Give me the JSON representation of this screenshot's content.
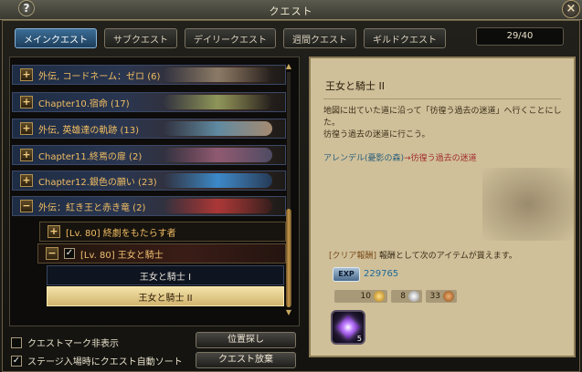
{
  "window": {
    "title": "クエスト",
    "help_label": "?",
    "close_label": "×"
  },
  "tabs": [
    {
      "label": "メインクエスト",
      "active": true
    },
    {
      "label": "サブクエスト",
      "active": false
    },
    {
      "label": "デイリークエスト",
      "active": false
    },
    {
      "label": "週間クエスト",
      "active": false
    },
    {
      "label": "ギルドクエスト",
      "active": false
    }
  ],
  "quest_count": "29/40",
  "quest_list": {
    "categories": [
      {
        "toggle": "+",
        "label": "外伝, コードネーム：ゼロ (6)"
      },
      {
        "toggle": "+",
        "label": "Chapter10.宿命 (17)"
      },
      {
        "toggle": "+",
        "label": "外伝, 英雄達の軌跡 (13)"
      },
      {
        "toggle": "+",
        "label": "Chapter11.終焉の扉 (2)"
      },
      {
        "toggle": "+",
        "label": "Chapter12.銀色の願い (23)"
      },
      {
        "toggle": "−",
        "label": "外伝：紅き王と赤き竜 (2)"
      }
    ],
    "subgroups": [
      {
        "toggle": "+",
        "label": "[Lv. 80] 終劇をもたらす者"
      },
      {
        "toggle": "−",
        "checked": "✓",
        "label": "[Lv. 80] 王女と騎士"
      }
    ],
    "items": [
      {
        "label": "王女と騎士 I",
        "selected": false
      },
      {
        "label": "王女と騎士 II",
        "selected": true
      }
    ]
  },
  "options": {
    "hide_quest_mark": {
      "label": "クエストマーク非表示",
      "checked": ""
    },
    "auto_sort": {
      "label": "ステージ入場時にクエスト自動ソート",
      "checked": "✓"
    }
  },
  "buttons": {
    "locate": "位置探し",
    "abandon": "クエスト放棄"
  },
  "detail": {
    "title": "王女と騎士 II",
    "description_1": "地図に出ていた道に沿って「彷徨う過去の迷道」へ行くことにした。",
    "description_2": "彷徨う過去の迷道に行こう。",
    "route_from": "アレンデル(憂影の森)",
    "route_arrow": "→",
    "route_to": "彷徨う過去の迷道",
    "reward_tag": "[クリア報酬]",
    "reward_text": " 報酬として次のアイテムが貰えます。",
    "exp_label": "EXP",
    "exp_value": "229765",
    "gold": "10",
    "silver": "8",
    "copper": "33",
    "item_count": "5"
  }
}
